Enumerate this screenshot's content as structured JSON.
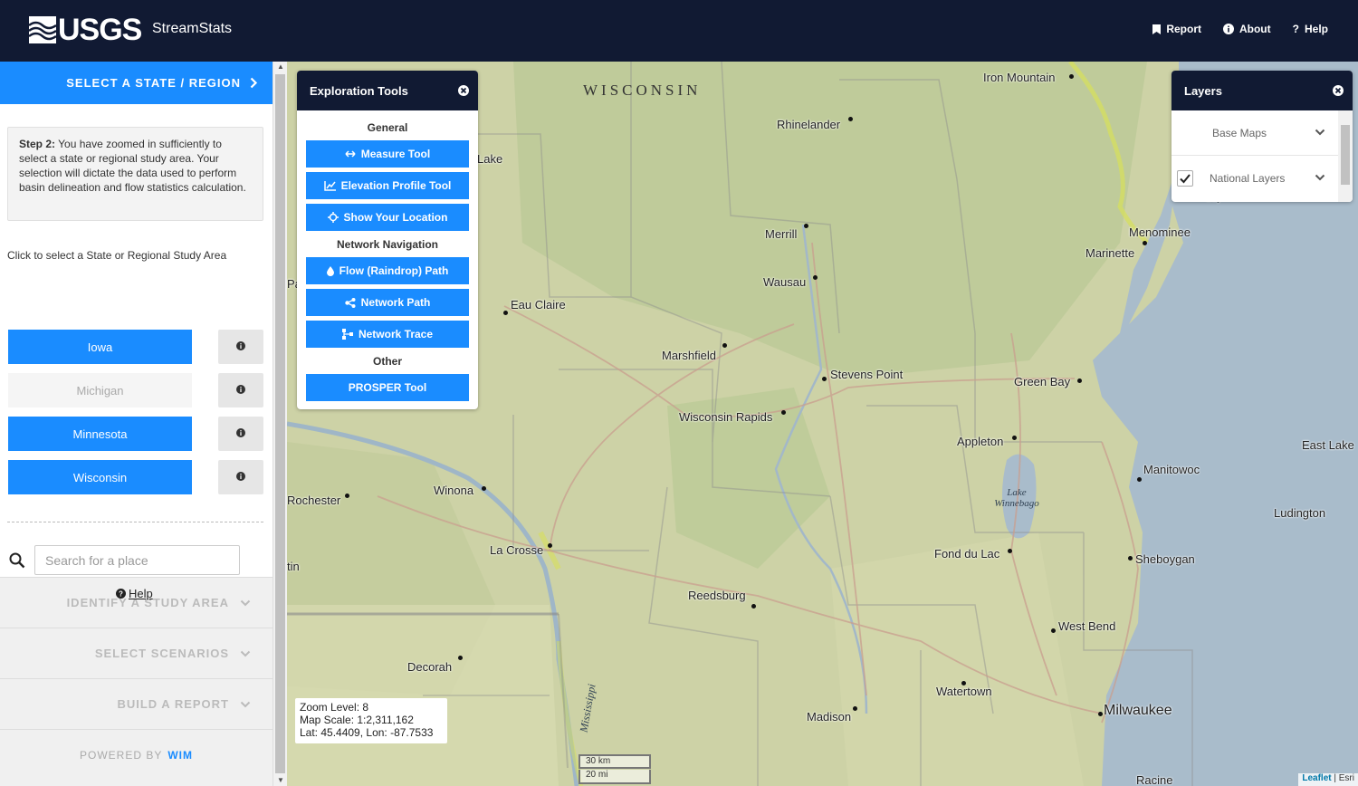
{
  "header": {
    "logo_text": "USGS",
    "app_title": "StreamStats",
    "nav": [
      {
        "label": "Report",
        "icon": "bookmark-icon"
      },
      {
        "label": "About",
        "icon": "info-circle-icon"
      },
      {
        "label": "Help",
        "icon": "question-icon"
      }
    ],
    "background_color": "#111a33"
  },
  "sidebar": {
    "active_step": {
      "label": "SELECT A STATE / REGION",
      "note_bold": "Step 2:",
      "note_text": " You have zoomed in sufficiently to select a state or regional study area. Your selection will dictate the data used to perform basin delineation and flow statistics calculation.",
      "prompt": "Click to select a State or Regional Study Area",
      "regions": [
        {
          "label": "Iowa",
          "enabled": true
        },
        {
          "label": "Michigan",
          "enabled": false
        },
        {
          "label": "Minnesota",
          "enabled": true
        },
        {
          "label": "Wisconsin",
          "enabled": true
        }
      ],
      "search_placeholder": "Search for a place",
      "help_label": "Help"
    },
    "collapsed_steps": [
      {
        "label": "IDENTIFY A STUDY AREA"
      },
      {
        "label": "SELECT SCENARIOS"
      },
      {
        "label": "BUILD A REPORT"
      }
    ],
    "powered_by": "POWERED BY",
    "powered_by_org": "WIM",
    "accent_color": "#1a8cff"
  },
  "tools_panel": {
    "title": "Exploration Tools",
    "sections": [
      {
        "label": "General",
        "tools": [
          {
            "label": "Measure Tool",
            "icon": "measure-icon"
          },
          {
            "label": "Elevation Profile Tool",
            "icon": "chart-line-icon"
          },
          {
            "label": "Show Your Location",
            "icon": "crosshairs-icon"
          }
        ]
      },
      {
        "label": "Network Navigation",
        "tools": [
          {
            "label": "Flow (Raindrop) Path",
            "icon": "raindrop-icon"
          },
          {
            "label": "Network Path",
            "icon": "share-nodes-icon"
          },
          {
            "label": "Network Trace",
            "icon": "sitemap-icon"
          }
        ]
      },
      {
        "label": "Other",
        "tools": [
          {
            "label": "PROSPER Tool",
            "icon": ""
          }
        ]
      }
    ]
  },
  "layers_panel": {
    "title": "Layers",
    "items": [
      {
        "label": "Base Maps",
        "checked": null
      },
      {
        "label": "National Layers",
        "checked": true
      }
    ]
  },
  "map": {
    "state_label": "WISCONSIN",
    "lake_label": "Lake Winnebago",
    "river_label": "Mississippi",
    "cities": [
      "Iron Mountain",
      "Rhinelander",
      "Lake",
      "Merrill",
      "Wausau",
      "Menominee",
      "Marinette",
      "Eau Claire",
      "Marshfield",
      "Stevens Point",
      "Green Bay",
      "Wisconsin Rapids",
      "Appleton",
      "East Lake",
      "Manitowoc",
      "Rochester",
      "Winona",
      "Ludington",
      "La Crosse",
      "Fond du Lac",
      "Sheboygan",
      "Reedsburg",
      "West Bend",
      "Decorah",
      "Watertown",
      "Madison",
      "Milwaukee",
      "Racine",
      "tin",
      "Pa",
      "Bay"
    ],
    "readout": {
      "zoom": "Zoom Level: 8",
      "scale": "Map Scale: 1:2,311,162",
      "latlon": "Lat: 45.4409, Lon: -87.7533"
    },
    "scale_km": "30 km",
    "scale_mi": "20 mi",
    "attribution_leaflet": "Leaflet",
    "attribution_sep": " | ",
    "attribution_esri": "Esri"
  }
}
